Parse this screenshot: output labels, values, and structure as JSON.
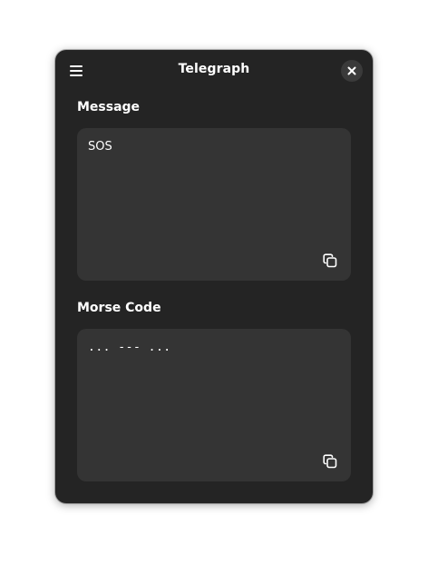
{
  "app": {
    "title": "Telegraph"
  },
  "headerbar": {
    "menu_icon": "hamburger-menu-icon",
    "close_icon": "close-icon"
  },
  "message": {
    "label": "Message",
    "value": "SOS",
    "copy_icon": "copy-icon"
  },
  "morse": {
    "label": "Morse Code",
    "value": "... --- ...",
    "copy_icon": "copy-icon"
  },
  "colors": {
    "window_bg": "#242424",
    "textbox_bg": "#343434",
    "close_button_bg": "#3a3a3a",
    "text": "#ffffff"
  }
}
